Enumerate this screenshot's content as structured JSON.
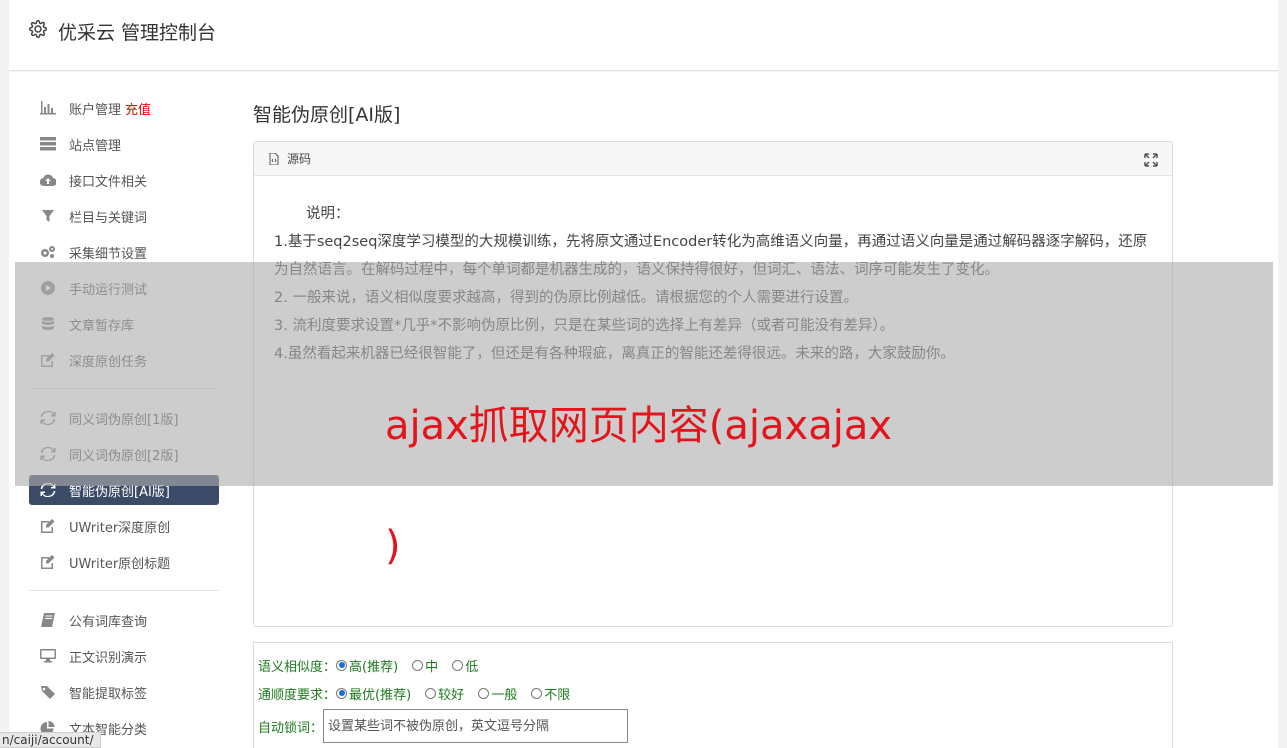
{
  "header": {
    "title": "优采云 管理控制台"
  },
  "sidebar": {
    "recharge_label": "充值",
    "group1": [
      {
        "label": "账户管理",
        "icon": "bar-chart-icon"
      },
      {
        "label": "站点管理",
        "icon": "server-icon"
      },
      {
        "label": "接口文件相关",
        "icon": "cloud-upload-icon"
      },
      {
        "label": "栏目与关键词",
        "icon": "filter-icon"
      },
      {
        "label": "采集细节设置",
        "icon": "gears-icon"
      },
      {
        "label": "手动运行测试",
        "icon": "play-icon"
      },
      {
        "label": "文章暂存库",
        "icon": "database-icon"
      },
      {
        "label": "深度原创任务",
        "icon": "edit-icon"
      }
    ],
    "group2": [
      {
        "label": "同义词伪原创[1版]",
        "icon": "refresh-icon"
      },
      {
        "label": "同义词伪原创[2版]",
        "icon": "refresh-icon"
      },
      {
        "label": "智能伪原创[AI版]",
        "icon": "refresh-icon"
      },
      {
        "label": "UWriter深度原创",
        "icon": "edit-icon"
      },
      {
        "label": "UWriter原创标题",
        "icon": "edit-icon"
      }
    ],
    "group3": [
      {
        "label": "公有词库查询",
        "icon": "book-icon"
      },
      {
        "label": "正文识别演示",
        "icon": "monitor-icon"
      },
      {
        "label": "智能提取标签",
        "icon": "tag-icon"
      },
      {
        "label": "文本智能分类",
        "icon": "pie-chart-icon"
      }
    ]
  },
  "main": {
    "page_title": "智能伪原创[AI版]",
    "panel": {
      "head_label": "源码",
      "intro": "说明：",
      "lines": [
        "1.基于seq2seq深度学习模型的大规模训练，先将原文通过Encoder转化为高维语义向量，再通过语义向量是通过解码器逐字解码，还原为自然语言。在解码过程中，每个单词都是机器生成的，语义保持得很好，但词汇、语法、词序可能发生了变化。",
        "2. 一般来说，语义相似度要求越高，得到的伪原比例越低。请根据您的个人需要进行设置。",
        "3. 流利度要求设置*几乎*不影响伪原比例，只是在某些词的选择上有差异（或者可能没有差异）。",
        "4.虽然看起来机器已经很智能了，但还是有各种瑕疵，离真正的智能还差得很远。未来的路，大家鼓励你。"
      ]
    }
  },
  "overlay": {
    "line1": "ajax抓取网页内容(ajaxajax",
    "line2": ")"
  },
  "form": {
    "similarity_label": "语义相似度：",
    "similarity_options": [
      "高(推荐)",
      "中",
      "低"
    ],
    "fluency_label": "通顺度要求：",
    "fluency_options": [
      "最优(推荐)",
      "较好",
      "一般",
      "不限"
    ],
    "lock_label": "自动锁词：",
    "lock_placeholder": "设置某些词不被伪原创，英文逗号分隔"
  },
  "status_bar": {
    "url": "n/caiji/account/"
  }
}
